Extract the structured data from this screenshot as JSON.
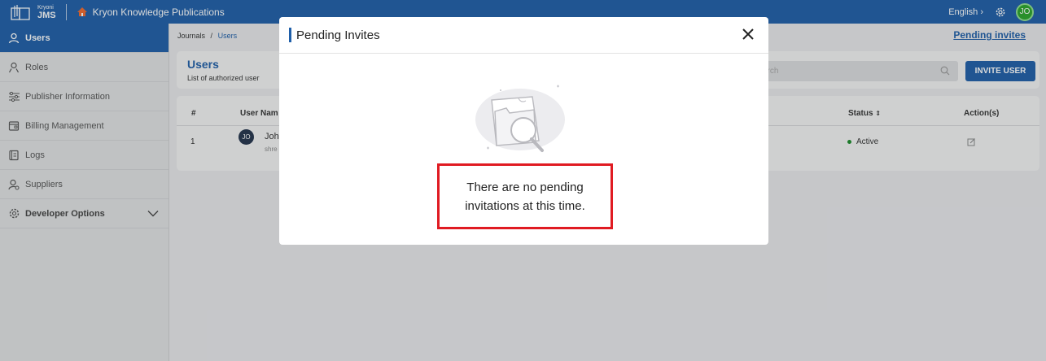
{
  "topbar": {
    "logo_small": "Kryoni",
    "logo_big": "JMS",
    "org_name": "Kryon Knowledge Publications",
    "language": "English",
    "user_initials": "JO"
  },
  "sidebar": {
    "items": [
      {
        "label": "Users",
        "icon": "user-icon"
      },
      {
        "label": "Roles",
        "icon": "roles-icon"
      },
      {
        "label": "Publisher Information",
        "icon": "sliders-icon"
      },
      {
        "label": "Billing Management",
        "icon": "billing-icon"
      },
      {
        "label": "Logs",
        "icon": "logs-icon"
      },
      {
        "label": "Suppliers",
        "icon": "suppliers-icon"
      },
      {
        "label": "Developer Options",
        "icon": "gear-icon"
      }
    ]
  },
  "breadcrumb": {
    "root": "Journals",
    "sep": "/",
    "current": "Users"
  },
  "pending_link": "Pending invites",
  "users_card": {
    "title": "Users",
    "subtitle": "List of authorized user",
    "search_placeholder": "arch",
    "invite_label": "INVITE USER"
  },
  "table": {
    "headers": {
      "num": "#",
      "user": "User Nam",
      "status": "Status",
      "action": "Action(s)"
    },
    "rows": [
      {
        "num": "1",
        "initials": "JO",
        "name": "Joh",
        "email": "shre",
        "status": "Active"
      }
    ]
  },
  "modal": {
    "title": "Pending Invites",
    "message": "There are no pending invitations at this time."
  },
  "colors": {
    "primary": "#1f5fa9",
    "highlight": "#e01b22",
    "active_status": "#1c8b2b"
  }
}
